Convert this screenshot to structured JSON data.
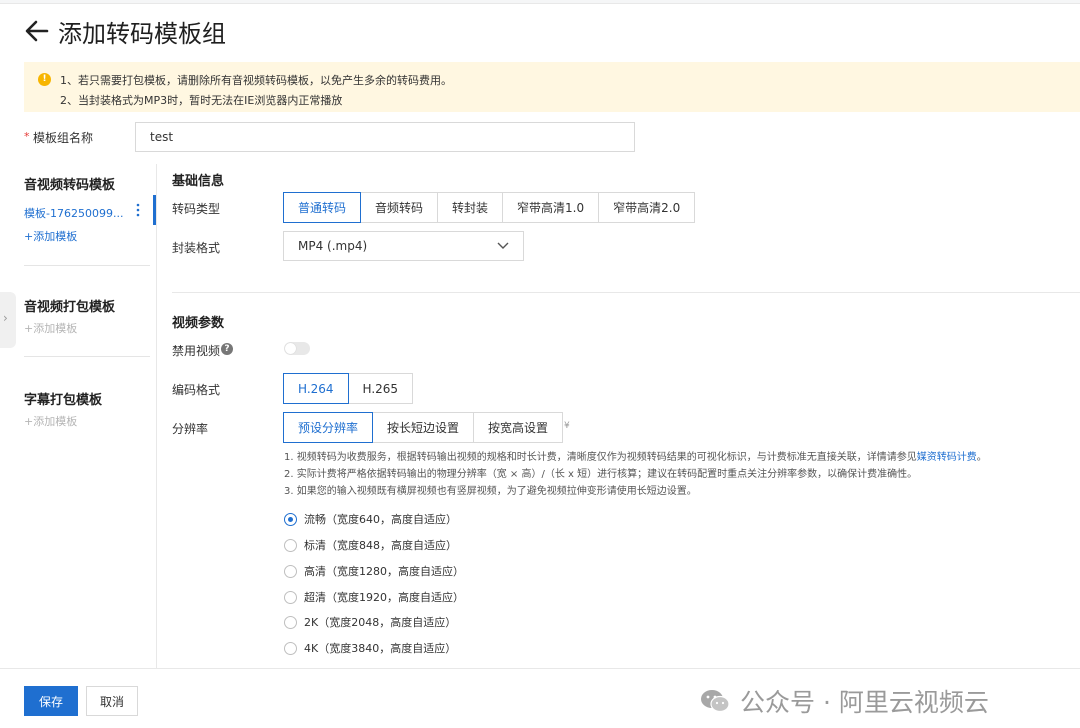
{
  "header": {
    "title": "添加转码模板组"
  },
  "notice": {
    "line1": "1、若只需要打包模板，请删除所有音视频转码模板，以免产生多余的转码费用。",
    "line2": "2、当封装格式为MP3时，暂时无法在IE浏览器内正常播放"
  },
  "name_field": {
    "label": "模板组名称",
    "value": "test"
  },
  "sidebar": {
    "transcode_title": "音视频转码模板",
    "transcode_item": "模板-176250099...",
    "transcode_add": "+添加模板",
    "package_title": "音视频打包模板",
    "package_add": "+添加模板",
    "subtitle_title": "字幕打包模板",
    "subtitle_add": "+添加模板"
  },
  "basic": {
    "title": "基础信息",
    "type_label": "转码类型",
    "types": [
      "普通转码",
      "音频转码",
      "转封装",
      "窄带高清1.0",
      "窄带高清2.0"
    ],
    "format_label": "封装格式",
    "format_value": "MP4 (.mp4)"
  },
  "video": {
    "title": "视频参数",
    "disable_label": "禁用视频",
    "codec_label": "编码格式",
    "codecs": [
      "H.264",
      "H.265"
    ],
    "res_label": "分辨率",
    "res_modes": [
      "预设分辨率",
      "按长短边设置",
      "按宽高设置"
    ],
    "yen": "¥",
    "notes": {
      "n1": "1. 视频转码为收费服务，根据转码输出视频的规格和时长计费，清晰度仅作为视频转码结果的可视化标识，与计费标准无直接关联，详情请参见",
      "n1_link": "媒资转码计费",
      "n1_end": "。",
      "n2": "2. 实际计费将严格依据转码输出的物理分辨率（宽 × 高）/（长 x 短）进行核算；建议在转码配置时重点关注分辨率参数，以确保计费准确性。",
      "n3": "3. 如果您的输入视频既有横屏视频也有竖屏视频，为了避免视频拉伸变形请使用长短边设置。"
    },
    "presets": [
      "流畅（宽度640，高度自适应）",
      "标清（宽度848，高度自适应）",
      "高清（宽度1280，高度自适应）",
      "超清（宽度1920，高度自适应）",
      "2K（宽度2048，高度自适应）",
      "4K（宽度3840，高度自适应）"
    ]
  },
  "footer": {
    "save": "保存",
    "cancel": "取消",
    "watermark": "公众号 · 阿里云视频云"
  },
  "colors": {
    "accent": "#1f6fd0",
    "notice_bg": "#fff7e1",
    "warn": "#f7b500"
  }
}
